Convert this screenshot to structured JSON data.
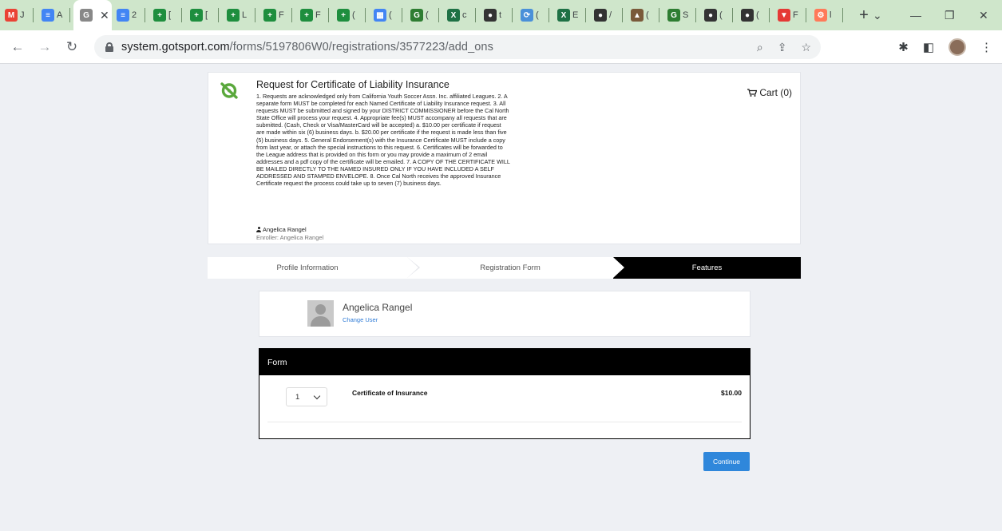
{
  "browser": {
    "tabs": [
      {
        "title": "J",
        "icon": "gmail-icon",
        "color": "#ea4335"
      },
      {
        "title": "A",
        "icon": "docs-icon",
        "color": "#4285f4"
      },
      {
        "title": "G",
        "icon": "gotsport-icon",
        "color": "#888888",
        "active": true
      },
      {
        "title": "2",
        "icon": "docs-icon",
        "color": "#4285f4"
      },
      {
        "title": "[",
        "icon": "sheets-plus-icon",
        "color": "#1e8e3e"
      },
      {
        "title": "[",
        "icon": "sheets-plus-icon",
        "color": "#1e8e3e"
      },
      {
        "title": "L",
        "icon": "sheets-plus-icon",
        "color": "#1e8e3e"
      },
      {
        "title": "F",
        "icon": "sheets-plus-icon",
        "color": "#1e8e3e"
      },
      {
        "title": "F",
        "icon": "sheets-plus-icon",
        "color": "#1e8e3e"
      },
      {
        "title": "(",
        "icon": "sheets-plus-icon",
        "color": "#1e8e3e"
      },
      {
        "title": "(",
        "icon": "calendar-icon",
        "color": "#4285f4"
      },
      {
        "title": "(",
        "icon": "gotsport-icon",
        "color": "#2e7d32"
      },
      {
        "title": "c",
        "icon": "excel-icon",
        "color": "#1e7145"
      },
      {
        "title": "t",
        "icon": "globe-icon",
        "color": "#333333"
      },
      {
        "title": "(",
        "icon": "sync-icon",
        "color": "#4a90d9"
      },
      {
        "title": "E",
        "icon": "excel-icon",
        "color": "#1e7145"
      },
      {
        "title": "/",
        "icon": "globe-icon",
        "color": "#333333"
      },
      {
        "title": "(",
        "icon": "mountain-icon",
        "color": "#7a5a3a"
      },
      {
        "title": "S",
        "icon": "gotsport-icon",
        "color": "#2e7d32"
      },
      {
        "title": "(",
        "icon": "globe-icon",
        "color": "#333333"
      },
      {
        "title": "(",
        "icon": "globe-icon",
        "color": "#333333"
      },
      {
        "title": "F",
        "icon": "shield-icon",
        "color": "#e53935"
      },
      {
        "title": "l",
        "icon": "hubspot-icon",
        "color": "#ff7a59"
      }
    ],
    "active_tab_close": "✕",
    "new_tab": "+",
    "url_domain": "system.gotsport.com",
    "url_path": "/forms/5197806W0/registrations/3577223/add_ons"
  },
  "header": {
    "title": "Request for Certificate of Liability Insurance",
    "body": "1. Requests are acknowledged only from California Youth Soccer Assn. Inc. affiliated Leagues. 2. A separate form MUST be completed for each Named Certificate of Liability Insurance request. 3. All requests MUST be submitted and signed by your DISTRICT COMMISSIONER before the Cal North State Office will process your request. 4. Appropriate fee(s) MUST accompany all requests that are submitted. (Cash, Check or Visa/MasterCard will be accepted) a. $10.00 per certificate if request are made within six (6) business days. b. $20.00 per certificate if the request is made less than five (5) business days. 5. General Endorsement(s) with the Insurance Certificate MUST include a copy from last year, or attach the special instructions to this request. 6. Certificates will be forwarded to the League address that is provided on this form or you may provide a maximum of 2 email addresses and a pdf copy of the certificate will be emailed. 7. A COPY OF THE CERTIFICATE WILL BE MAILED DIRECTLY TO THE NAMED INSURED ONLY IF YOU HAVE INCLUDED A SELF ADDRESSED AND STAMPED ENVELOPE. 8. Once Cal North receives the approved Insurance Certificate request the process could take up to seven (7) business days.",
    "user_name": "Angelica Rangel",
    "enroller": "Enroller: Angelica Rangel",
    "cart_label": "Cart (0)"
  },
  "steps": [
    "Profile Information",
    "Registration Form",
    "Features"
  ],
  "user_card": {
    "name": "Angelica Rangel",
    "change_user": "Change User"
  },
  "form": {
    "heading": "Form",
    "quantity": "1",
    "item_name": "Certificate of Insurance",
    "item_price": "$10.00"
  },
  "continue_label": "Continue",
  "colors": {
    "accent": "#2f87db",
    "logo_green": "#5aa83c",
    "tabstrip": "#cfe6cb"
  }
}
